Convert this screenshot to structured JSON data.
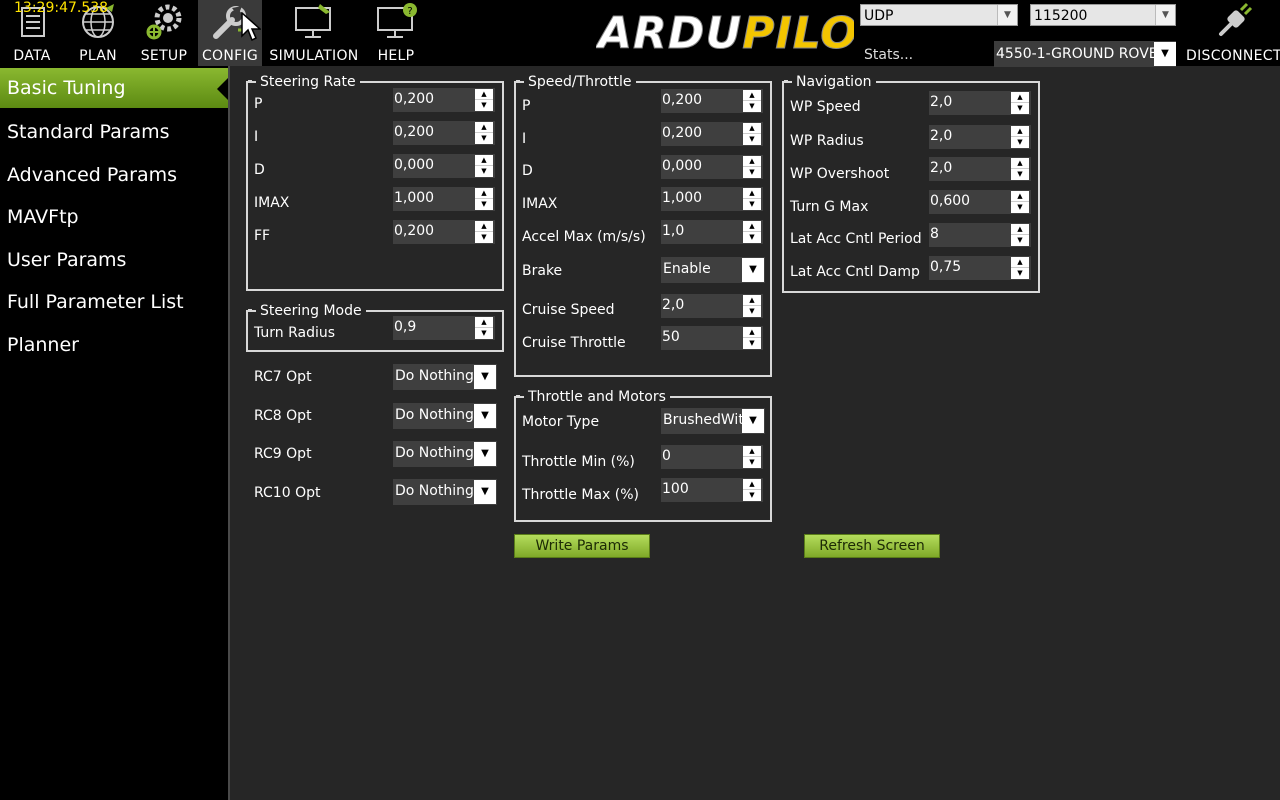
{
  "header": {
    "clock": "13:29:47.538",
    "nav": [
      {
        "label": "DATA",
        "icon": "data-icon"
      },
      {
        "label": "PLAN",
        "icon": "globe-icon"
      },
      {
        "label": "SETUP",
        "icon": "gears-icon"
      },
      {
        "label": "CONFIG",
        "icon": "wrench-icon"
      },
      {
        "label": "SIMULATION",
        "icon": "monitor-plane-icon"
      },
      {
        "label": "HELP",
        "icon": "monitor-help-icon"
      }
    ],
    "logo": {
      "part1": "ARDU",
      "part2": "PILOT"
    },
    "connection_type": "UDP",
    "baud_rate": "115200",
    "stats_label": "Stats...",
    "vehicle": "4550-1-GROUND ROVER",
    "disconnect_label": "DISCONNECT"
  },
  "sidebar": {
    "items": [
      {
        "label": "Basic Tuning",
        "active": true
      },
      {
        "label": "Standard Params"
      },
      {
        "label": "Advanced Params"
      },
      {
        "label": "MAVFtp"
      },
      {
        "label": "User Params"
      },
      {
        "label": "Full Parameter List"
      },
      {
        "label": "Planner"
      }
    ]
  },
  "steering_rate": {
    "title": "Steering Rate",
    "params": [
      {
        "label": "P",
        "value": "0,200"
      },
      {
        "label": "I",
        "value": "0,200"
      },
      {
        "label": "D",
        "value": "0,000"
      },
      {
        "label": "IMAX",
        "value": "1,000"
      },
      {
        "label": "FF",
        "value": "0,200"
      }
    ]
  },
  "steering_mode": {
    "title": "Steering Mode",
    "turn_radius_label": "Turn Radius",
    "turn_radius_value": "0,9"
  },
  "rc_options": [
    {
      "label": "RC7 Opt",
      "value": "Do Nothing"
    },
    {
      "label": "RC8 Opt",
      "value": "Do Nothing"
    },
    {
      "label": "RC9 Opt",
      "value": "Do Nothing"
    },
    {
      "label": "RC10 Opt",
      "value": "Do Nothing"
    }
  ],
  "speed_throttle": {
    "title": "Speed/Throttle",
    "params": [
      {
        "label": "P",
        "value": "0,200"
      },
      {
        "label": "I",
        "value": "0,200"
      },
      {
        "label": "D",
        "value": "0,000"
      },
      {
        "label": "IMAX",
        "value": "1,000"
      },
      {
        "label": "Accel Max (m/s/s)",
        "value": "1,0"
      }
    ],
    "brake_label": "Brake",
    "brake_value": "Enable",
    "cruise_speed_label": "Cruise Speed",
    "cruise_speed_value": "2,0",
    "cruise_throttle_label": "Cruise Throttle",
    "cruise_throttle_value": "50"
  },
  "throttle_motors": {
    "title": "Throttle and Motors",
    "motor_type_label": "Motor Type",
    "motor_type_value": "BrushedWith",
    "throttle_min_label": "Throttle Min (%)",
    "throttle_min_value": "0",
    "throttle_max_label": "Throttle Max (%)",
    "throttle_max_value": "100"
  },
  "navigation": {
    "title": "Navigation",
    "params": [
      {
        "label": "WP Speed",
        "value": "2,0"
      },
      {
        "label": "WP Radius",
        "value": "2,0"
      },
      {
        "label": "WP Overshoot",
        "value": "2,0"
      },
      {
        "label": "Turn G Max",
        "value": "0,600"
      },
      {
        "label": "Lat Acc Cntl Period",
        "value": "8"
      },
      {
        "label": "Lat Acc Cntl Damp",
        "value": "0,75"
      }
    ]
  },
  "actions": {
    "write_params": "Write Params",
    "refresh_screen": "Refresh Screen"
  },
  "colors": {
    "accent_green": "#8ab830",
    "logo_yellow": "#f3c500",
    "clock_yellow": "#ffe400",
    "background": "#262626"
  }
}
